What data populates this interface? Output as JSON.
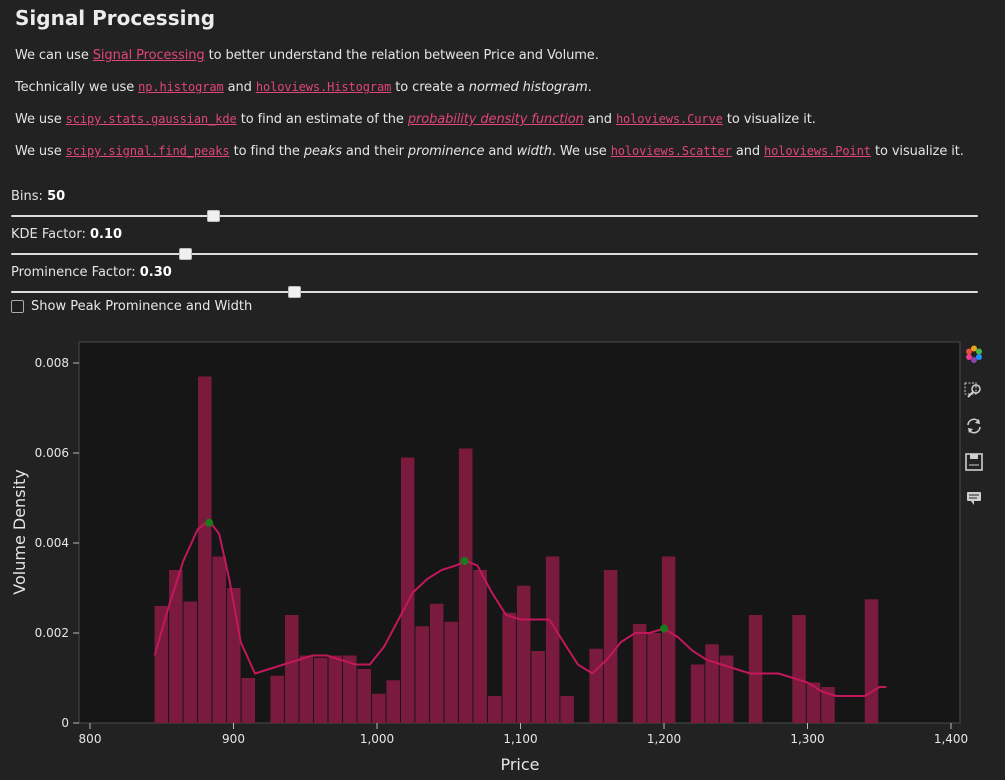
{
  "title": "Signal Processing",
  "paragraphs": {
    "p1": {
      "pre": "We can use ",
      "link": "Signal Processing",
      "post": " to better understand the relation between Price and Volume."
    },
    "p2": {
      "pre": "Technically we use ",
      "c1": "np.histogram",
      "and": " and ",
      "c2": "holoviews.Histogram",
      "mid": " to create a ",
      "em": "normed histogram",
      "post": "."
    },
    "p3": {
      "pre": "We use ",
      "c1": "scipy.stats.gaussian_kde",
      "mid": " to find an estimate of the ",
      "link": "probability density function",
      "and": " and ",
      "c2": "holoviews.Curve",
      "post": " to visualize it."
    },
    "p4": {
      "pre": "We use ",
      "c1": "scipy.signal.find_peaks",
      "a": " to find the ",
      "e1": "peaks",
      "b": " and their ",
      "e2": "prominence",
      "c": " and ",
      "e3": "width",
      "d": ". We use ",
      "c2": "holoviews.Scatter",
      "and": " and ",
      "c3": "holoviews.Point",
      "post": " to visualize it."
    }
  },
  "sliders": {
    "bins": {
      "label": "Bins: ",
      "value": "50",
      "fraction": 0.209
    },
    "kde": {
      "label": "KDE Factor: ",
      "value": "0.10",
      "fraction": 0.18
    },
    "prominence": {
      "label": "Prominence Factor: ",
      "value": "0.30",
      "fraction": 0.293
    }
  },
  "checkbox": {
    "label": "Show Peak Prominence and Width",
    "checked": false
  },
  "toolbar": [
    "bokeh-logo-icon",
    "box-zoom-icon",
    "reset-icon",
    "save-icon",
    "hover-icon"
  ],
  "colors": {
    "bar": "#7a1a3c",
    "curve": "#c2185b",
    "peak": "#1b7a1b",
    "link": "#e0457b"
  },
  "chart_data": {
    "type": "bar",
    "xlabel": "Price",
    "ylabel": "Volume Density",
    "xlim": [
      800,
      1400
    ],
    "ylim": [
      0,
      0.008
    ],
    "xticks": [
      "800",
      "900",
      "1,000",
      "1,100",
      "1,200",
      "1,300",
      "1,400"
    ],
    "yticks": [
      "0",
      "0.002",
      "0.004",
      "0.006",
      "0.008"
    ],
    "bin_edges_start": 845,
    "bin_width": 10.1,
    "histogram": [
      0.0026,
      0.0034,
      0.0027,
      0.0077,
      0.0037,
      0.003,
      0.001,
      0,
      0.00105,
      0.0024,
      0.0015,
      0.00145,
      0.0015,
      0.0015,
      0.0012,
      0.00065,
      0.00095,
      0.0059,
      0.00215,
      0.00265,
      0.00225,
      0.0061,
      0.0034,
      0.0006,
      0.00245,
      0.00305,
      0.0016,
      0.0037,
      0.0006,
      0,
      0.00165,
      0.0034,
      0,
      0.0022,
      0.002,
      0.0037,
      0,
      0.0013,
      0.00175,
      0.0015,
      0,
      0.0024,
      0,
      0,
      0.0024,
      0.0009,
      0.0008,
      0,
      0,
      0.00275
    ],
    "kde": {
      "x": [
        845,
        855,
        865,
        875,
        883,
        890,
        897,
        905,
        915,
        925,
        935,
        945,
        955,
        965,
        975,
        985,
        995,
        1005,
        1015,
        1025,
        1035,
        1045,
        1055,
        1062,
        1070,
        1080,
        1090,
        1100,
        1110,
        1120,
        1130,
        1140,
        1150,
        1160,
        1170,
        1180,
        1190,
        1200,
        1210,
        1220,
        1230,
        1240,
        1250,
        1260,
        1270,
        1280,
        1290,
        1300,
        1310,
        1320,
        1330,
        1340,
        1350,
        1355
      ],
      "y": [
        0.0015,
        0.0026,
        0.0036,
        0.0043,
        0.0045,
        0.0042,
        0.0032,
        0.0018,
        0.0011,
        0.0012,
        0.0013,
        0.0014,
        0.0015,
        0.0015,
        0.0014,
        0.0013,
        0.0013,
        0.0017,
        0.0023,
        0.0029,
        0.0032,
        0.0034,
        0.0035,
        0.0036,
        0.0035,
        0.0029,
        0.0024,
        0.0023,
        0.0023,
        0.0023,
        0.0018,
        0.0013,
        0.0011,
        0.0014,
        0.0018,
        0.002,
        0.002,
        0.0021,
        0.0019,
        0.0016,
        0.0014,
        0.0013,
        0.0012,
        0.0011,
        0.0011,
        0.0011,
        0.001,
        0.0009,
        0.0007,
        0.0006,
        0.0006,
        0.0006,
        0.0008,
        0.0008
      ]
    },
    "peaks": [
      {
        "x": 883,
        "y": 0.00445
      },
      {
        "x": 1061,
        "y": 0.0036
      },
      {
        "x": 1200,
        "y": 0.0021
      }
    ]
  }
}
